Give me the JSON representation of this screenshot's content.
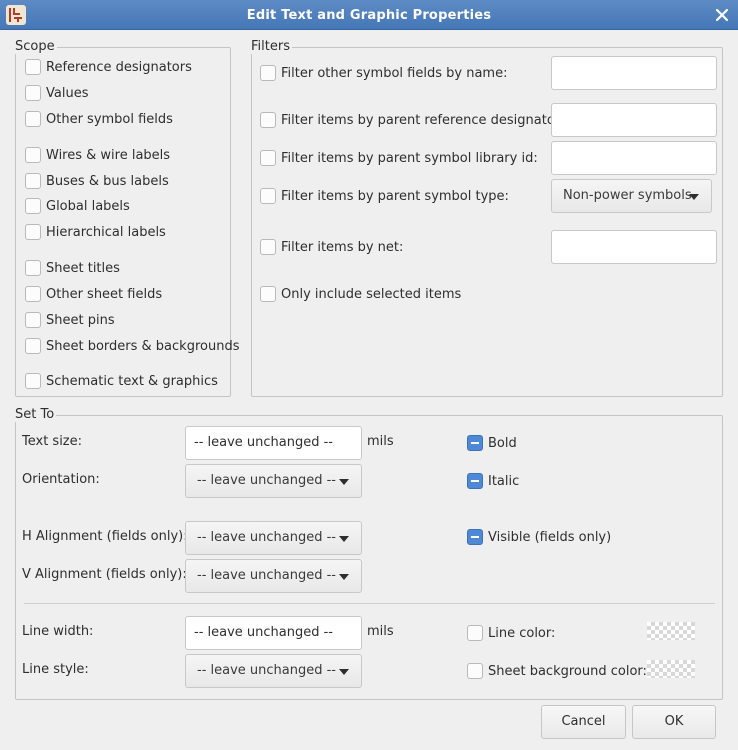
{
  "window": {
    "title": "Edit Text and Graphic Properties",
    "app_icon": "kicad-eeschema-icon",
    "close_icon": "close-icon"
  },
  "scope": {
    "legend": "Scope",
    "items": [
      {
        "label": "Reference designators",
        "checked": false
      },
      {
        "label": "Values",
        "checked": false
      },
      {
        "label": "Other symbol fields",
        "checked": false
      },
      {
        "label": "Wires & wire labels",
        "checked": false
      },
      {
        "label": "Buses & bus labels",
        "checked": false
      },
      {
        "label": "Global labels",
        "checked": false
      },
      {
        "label": "Hierarchical labels",
        "checked": false
      },
      {
        "label": "Sheet titles",
        "checked": false
      },
      {
        "label": "Other sheet fields",
        "checked": false
      },
      {
        "label": "Sheet pins",
        "checked": false
      },
      {
        "label": "Sheet borders & backgrounds",
        "checked": false
      },
      {
        "label": "Schematic text & graphics",
        "checked": false
      }
    ]
  },
  "filters": {
    "legend": "Filters",
    "by_name": {
      "label": "Filter other symbol fields by name:",
      "value": ""
    },
    "by_ref": {
      "label": "Filter items by parent reference designator:",
      "value": ""
    },
    "by_libid": {
      "label": "Filter items by parent symbol library id:",
      "value": ""
    },
    "by_type": {
      "label": "Filter items by parent symbol type:",
      "value": "Non-power symbols"
    },
    "by_net": {
      "label": "Filter items by net:",
      "value": ""
    },
    "selected_only": {
      "label": "Only include selected items"
    }
  },
  "set_to": {
    "legend": "Set To",
    "text_size": {
      "label": "Text size:",
      "value": "-- leave unchanged --",
      "unit": "mils"
    },
    "orientation": {
      "label": "Orientation:",
      "value": "-- leave unchanged --"
    },
    "h_align": {
      "label": "H Alignment (fields only):",
      "value": "-- leave unchanged --"
    },
    "v_align": {
      "label": "V Alignment (fields only):",
      "value": "-- leave unchanged --"
    },
    "bold": {
      "label": "Bold",
      "state": "indeterminate"
    },
    "italic": {
      "label": "Italic",
      "state": "indeterminate"
    },
    "visible": {
      "label": "Visible (fields only)",
      "state": "indeterminate"
    },
    "line_width": {
      "label": "Line width:",
      "value": "-- leave unchanged --",
      "unit": "mils"
    },
    "line_style": {
      "label": "Line style:",
      "value": "-- leave unchanged --"
    },
    "line_color": {
      "label": "Line color:"
    },
    "sheet_bg_color": {
      "label": "Sheet background color:"
    }
  },
  "buttons": {
    "cancel": "Cancel",
    "ok": "OK"
  },
  "colors": {
    "titlebar": "#4f80be",
    "indeterminate_check": "#4d89d6",
    "dialog_bg": "#efefef"
  }
}
